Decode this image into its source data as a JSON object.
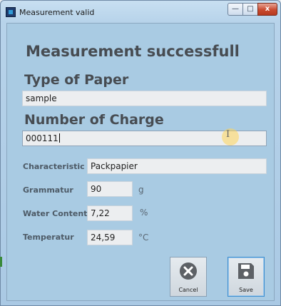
{
  "window": {
    "title": "Measurement valid",
    "controls": {
      "minimize": "—",
      "maximize": "□",
      "close": "x"
    }
  },
  "form": {
    "status_heading": "Measurement successfull",
    "type_of_paper": {
      "label": "Type of Paper",
      "value": "sample"
    },
    "number_of_charge": {
      "label": "Number of Charge",
      "value": "000111"
    },
    "characteristic": {
      "label": "Characteristic",
      "value": "Packpapier"
    },
    "grammatur": {
      "label": "Grammatur",
      "value": "90",
      "unit": "g"
    },
    "water_content": {
      "label": "Water Content",
      "value": "7,22",
      "unit": "%"
    },
    "temperatur": {
      "label": "Temperatur",
      "value": "24,59",
      "unit": "°C"
    }
  },
  "buttons": {
    "cancel": {
      "label": "Cancel",
      "icon": "close-circle-icon"
    },
    "save": {
      "label": "Save",
      "icon": "floppy-disk-icon"
    }
  },
  "colors": {
    "panel": "#a9cbe3",
    "heading": "#474c52",
    "field": "#eceef0",
    "save_focus": "#3f8fd0"
  }
}
